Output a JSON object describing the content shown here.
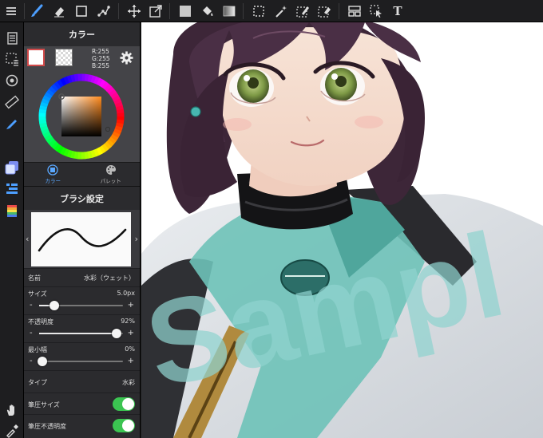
{
  "toolbar": {
    "icons": [
      "menu-icon",
      "brush-icon",
      "eraser-icon",
      "rectangle-icon",
      "polyline-icon",
      "move-icon",
      "transform-icon",
      "fill-color-icon",
      "bucket-icon",
      "gradient-icon",
      "select-rect-icon",
      "magic-wand-icon",
      "select-pen-icon",
      "select-eraser-icon",
      "layout-icon",
      "select-move-icon",
      "text-icon"
    ],
    "text_label": "T"
  },
  "rail": {
    "icons": [
      "pages-icon",
      "selection-icon",
      "rotate-icon",
      "ruler-icon",
      "pen-icon",
      "layers-icon",
      "layer-list-icon",
      "color-icon",
      "hand-icon",
      "eyedropper-icon"
    ]
  },
  "color_panel": {
    "title": "カラー",
    "rgb": {
      "r": "R:255",
      "g": "G:255",
      "b": "B:255"
    },
    "tabs": [
      {
        "label": "カラー",
        "active": true
      },
      {
        "label": "パレット",
        "active": false
      }
    ]
  },
  "brush_panel": {
    "title": "ブラシ設定",
    "name_label": "名前",
    "name_value": "水彩（ウェット）",
    "size": {
      "label": "サイズ",
      "value": "5.0px",
      "minus": "-",
      "plus": "+",
      "level": 0.18
    },
    "opacity": {
      "label": "不透明度",
      "value": "92%",
      "minus": "-",
      "plus": "+",
      "level": 0.92
    },
    "min_width": {
      "label": "最小幅",
      "value": "0%",
      "minus": "-",
      "plus": "+",
      "level": 0.04
    },
    "type": {
      "label": "タイプ",
      "value": "水彩"
    },
    "pressure_size": {
      "label": "筆圧サイズ",
      "on": true
    },
    "pressure_opacity": {
      "label": "筆圧不透明度",
      "on": true
    }
  },
  "canvas": {
    "watermark": "Sampl"
  },
  "colors": {
    "accent_blue": "#5aa8ff",
    "toggle_green": "#3bc451",
    "watermark_teal": "#8fd3cf",
    "hair": "#4a2f45",
    "eyes": "#7e9a46"
  }
}
